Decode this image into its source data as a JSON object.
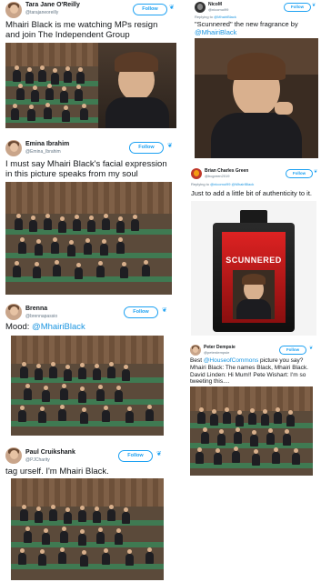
{
  "follow_label": "Follow",
  "tweets": [
    {
      "name": "Tara Jane O'Reilly",
      "handle": "@tarajaneoreilly",
      "text": "Mhairi Black is me watching MPs resign and join The Independent Group"
    },
    {
      "name": "Emina Ibrahim",
      "handle": "@Emina_Ibrahim",
      "text": "I must say Mhairi Black's facial expression in this picture speaks from my soul"
    },
    {
      "name": "Brenna",
      "handle": "@brennapassio",
      "text_prefix": "Mood: ",
      "mention": "@MhairiBlack"
    },
    {
      "name": "Paul Cruikshank",
      "handle": "@PJCharity",
      "text": "tag urself. I'm Mhairi Black."
    },
    {
      "name": "NicoM",
      "handle": "@nicomoi99",
      "reply_prefix": "Replying to ",
      "reply_to": "@MhairiBlack",
      "text": "\"Scunnered\" the new fragrance by",
      "mention": "@MhairiBlack"
    },
    {
      "name": "Brian Charles Green",
      "handle": "@bcgreen2019",
      "reply_prefix": "Replying to ",
      "reply_to": "@nicomoi99 @MhairiBlack",
      "text": "Just to add a little bit of authenticity to it.",
      "bottle_label": "SCUNNERED"
    },
    {
      "name": "Peter Dempsie",
      "handle": "@peterdempsie",
      "text_prefix": "Best ",
      "mention": "@HouseofCommons",
      "text": " picture you say? Mhairi Black: The names Black, Mhairi Black. David Linden: Hi Mum!! Pete Wishart: I'm so tweeting this...."
    }
  ],
  "colors": {
    "accent": "#1da1f2",
    "text": "#14171a",
    "muted": "#657786",
    "bench_green": "#3f7a52",
    "wood": "#6d5039"
  },
  "icons": {
    "bird": "twitter-bird-icon"
  }
}
